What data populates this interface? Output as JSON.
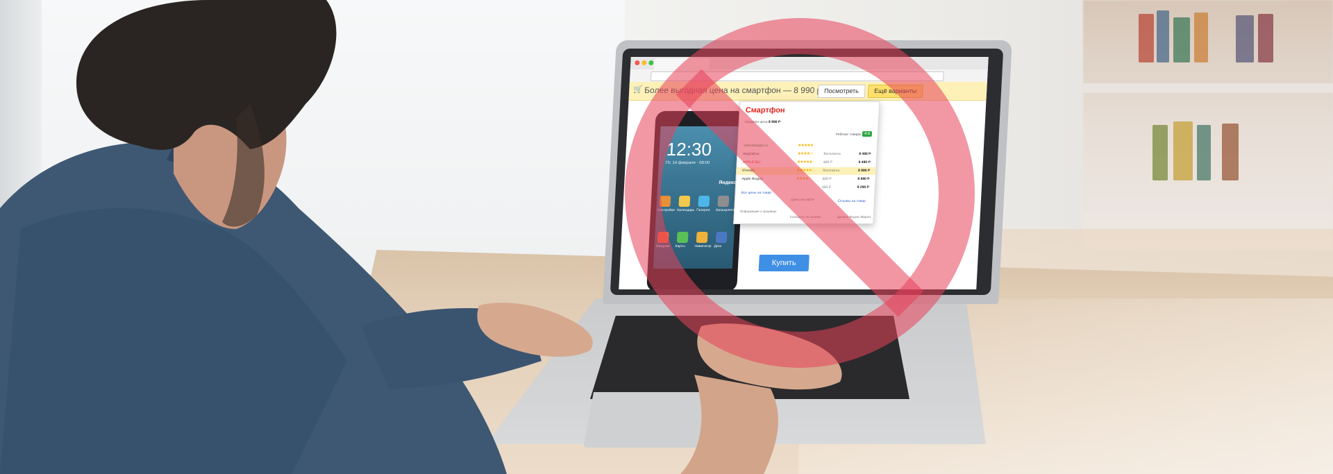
{
  "browser": {
    "sovetnik_text": "Более выгодная цена на смартфон — 8 990 р.",
    "look_button": "Посмотреть",
    "more_button": "Ещё варианты"
  },
  "phone": {
    "time": "12:30",
    "date": "Пт, 14 февраля · 08:00",
    "brand": "Яндекс",
    "apps": [
      "Настройки",
      "Календарь",
      "Галерея",
      "Калькулятор",
      "Загрузки",
      "Карты",
      "Навигатор",
      "Диск"
    ]
  },
  "popup": {
    "title": "Смартфон",
    "avg_label": "Средняя цена",
    "avg_price": "8 990 Р",
    "rating_label": "Рейтинг товара",
    "rating_value": "4.6",
    "shops": [
      {
        "name": "Videoshoppe.ru",
        "stars": "★★★★★",
        "delivery": "",
        "price": ""
      },
      {
        "name": "KeyCell.ru",
        "stars": "★★★★☆",
        "delivery": "бесплатно",
        "price": "9 490 Р"
      },
      {
        "name": "APPLE-RU",
        "stars": "★★★★★",
        "delivery": "400 Р",
        "price": "9 490 Р"
      },
      {
        "name": "iFrendly",
        "stars": "★★★★★",
        "delivery": "бесплатно",
        "price": "8 990 Р"
      },
      {
        "name": "Apple Region",
        "stars": "★★★★☆",
        "delivery": "500 Р",
        "price": "8 990 Р"
      },
      {
        "name": "",
        "stars": "",
        "delivery": "450 Р",
        "price": "8 290 Р"
      }
    ],
    "all_prices_link": "Все цены на товар",
    "cards_link": "Цены на карте",
    "reviews_link": "Отзывы на товар",
    "info_link": "Информация о продавце",
    "error_link": "Сообщить об ошибке",
    "data_source": "Данные Яндекс.Маркет"
  },
  "page": {
    "buy_button": "Купить"
  },
  "colors": {
    "forbid_red": "#e8415a",
    "sovetnik_yellow": "#fdf1b8",
    "buy_blue": "#3f8fe5",
    "shirt_blue": "#3e5873"
  }
}
